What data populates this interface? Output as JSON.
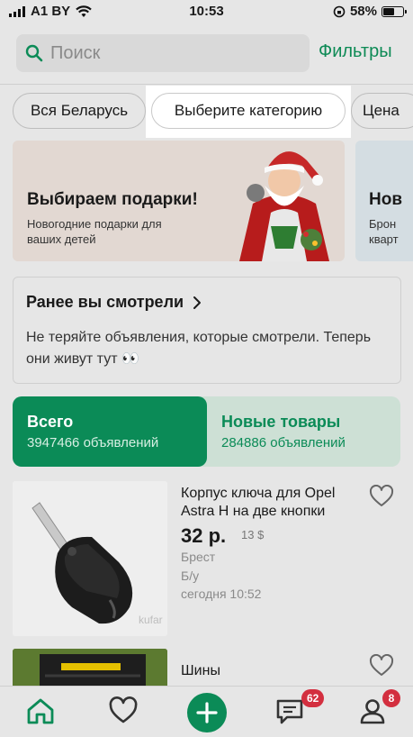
{
  "status_bar": {
    "carrier": "A1 BY",
    "time": "10:53",
    "battery": "58%",
    "battery_level": 0.58
  },
  "search": {
    "placeholder": "Поиск"
  },
  "filters_label": "Фильтры",
  "chips": [
    "Вся Беларусь",
    "Выберите категорию",
    "Цена"
  ],
  "banners": [
    {
      "title": "Выбираем подарки!",
      "subtitle": "Новогодние подарки для ваших детей"
    },
    {
      "title": "Нов",
      "subtitle_lines": [
        "Брон",
        "кварт"
      ]
    }
  ],
  "recent": {
    "title": "Ранее вы смотрели",
    "description": "Не теряйте объявления, которые смотрели. Теперь они живут тут 👀"
  },
  "stats": {
    "all": {
      "label": "Всего",
      "count": "3947466 объявлений"
    },
    "new": {
      "label": "Новые товары",
      "count": "284886 объявлений"
    }
  },
  "listings": [
    {
      "title": "Корпус ключа для Opel Astra H на две кнопки",
      "price": "32 р.",
      "alt_price": "13 $",
      "city": "Брест",
      "condition": "Б/у",
      "date": "сегодня 10:52",
      "watermark": "kufar"
    },
    {
      "title": "Шины"
    }
  ],
  "tabbar": {
    "items": [
      "home-icon",
      "heart-icon",
      "add-icon",
      "chat-icon",
      "profile-icon"
    ],
    "messages_badge": "62",
    "profile_badge": "8"
  },
  "colors": {
    "accent": "#0b8b57",
    "badge": "#d32f3f"
  }
}
